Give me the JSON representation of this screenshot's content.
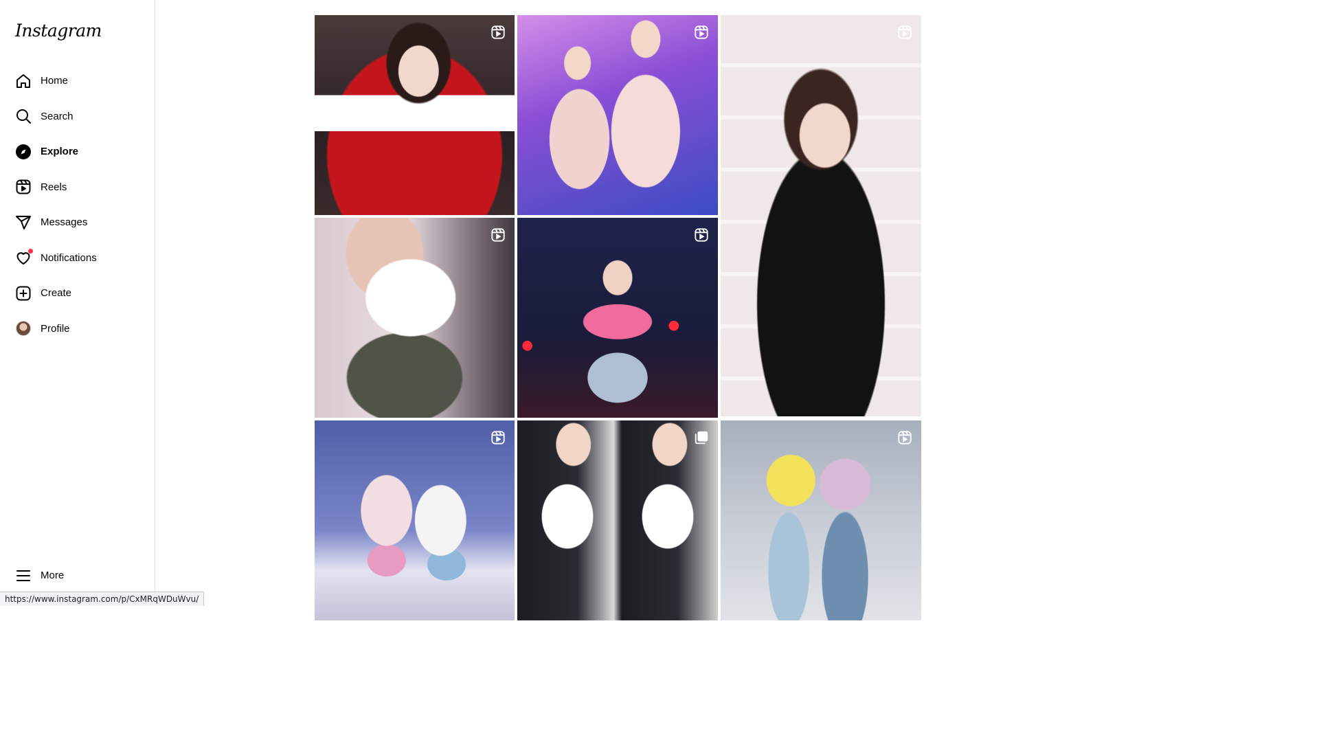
{
  "app": {
    "logo_text": "Instagram"
  },
  "sidebar": {
    "items": [
      {
        "label": "Home",
        "icon": "home-icon",
        "active": false
      },
      {
        "label": "Search",
        "icon": "search-icon",
        "active": false
      },
      {
        "label": "Explore",
        "icon": "explore-compass-icon",
        "active": true
      },
      {
        "label": "Reels",
        "icon": "reels-icon",
        "active": false
      },
      {
        "label": "Messages",
        "icon": "messages-paper-plane-icon",
        "active": false
      },
      {
        "label": "Notifications",
        "icon": "heart-icon",
        "active": false,
        "has_unread_dot": true
      },
      {
        "label": "Create",
        "icon": "plus-square-icon",
        "active": false
      },
      {
        "label": "Profile",
        "icon": "avatar",
        "active": false
      }
    ],
    "more": {
      "label": "More",
      "icon": "hamburger-menu-icon"
    }
  },
  "status_bar": {
    "hover_url": "https://www.instagram.com/p/CxMRqWDuWvu/"
  },
  "explore_grid": {
    "tiles": [
      {
        "type": "reel",
        "badge_icon": "reel-badge-icon",
        "description": "performer in red varsity jacket"
      },
      {
        "type": "reel",
        "badge_icon": "reel-badge-icon",
        "description": "two performers in pink outfits on stage"
      },
      {
        "type": "reel",
        "badge_icon": "reel-badge-icon",
        "description": "woman in black blazer in store",
        "tall": true
      },
      {
        "type": "reel",
        "badge_icon": "reel-badge-icon",
        "description": "performer in white top holding mic"
      },
      {
        "type": "reel",
        "badge_icon": "reel-badge-icon",
        "description": "performer in floral top on dark stage"
      },
      {
        "type": "reel",
        "badge_icon": "reel-badge-icon",
        "description": "two performers making heart shape"
      },
      {
        "type": "carousel",
        "badge_icon": "carousel-badge-icon",
        "description": "side-by-side performer photos"
      },
      {
        "type": "reel",
        "badge_icon": "reel-badge-icon",
        "description": "two performers in crochet tops"
      }
    ]
  },
  "colors": {
    "notification_dot": "#ff3040",
    "border": "#dbdbdb",
    "text": "#000000"
  }
}
